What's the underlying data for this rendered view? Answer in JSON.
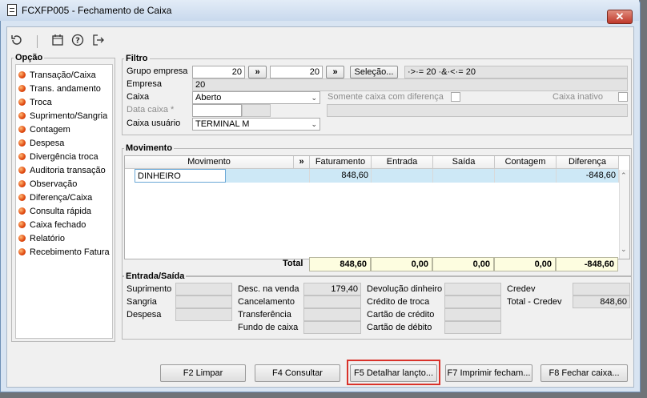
{
  "window": {
    "title": "FCXFP005 - Fechamento de Caixa",
    "close_label": "✕"
  },
  "toolbar": {
    "icons": [
      "refresh-icon",
      "calendar-icon",
      "help-icon",
      "exit-icon"
    ]
  },
  "opcao": {
    "label": "Opção",
    "items": [
      "Transação/Caixa",
      "Trans. andamento",
      "Troca",
      "Suprimento/Sangria",
      "Contagem",
      "Despesa",
      "Divergência troca",
      "Auditoria transação",
      "Observação",
      "Diferença/Caixa",
      "Consulta rápida",
      "Caixa fechado",
      "Relatório",
      "Recebimento Fatura"
    ]
  },
  "filtro": {
    "label": "Filtro",
    "grupo_empresa_label": "Grupo empresa",
    "grupo_empresa_from": "20",
    "grupo_empresa_to": "20",
    "range_btn": "»",
    "selecao_btn": "Seleção...",
    "selection_text": "·>·= 20 ·&·<·= 20",
    "empresa_label": "Empresa",
    "empresa_value": "20",
    "caixa_label": "Caixa",
    "caixa_value": "Aberto",
    "somente_label": "Somente caixa com diferença",
    "inativo_label": "Caixa inativo",
    "data_caixa_label": "Data caixa *",
    "caixa_usuario_label": "Caixa usuário",
    "caixa_usuario_value": "TERMINAL M"
  },
  "movimento": {
    "label": "Movimento",
    "columns": {
      "movimento": "Movimento",
      "expand": "»",
      "faturamento": "Faturamento",
      "entrada": "Entrada",
      "saida": "Saída",
      "contagem": "Contagem",
      "diferenca": "Diferença"
    },
    "rows": [
      {
        "movimento": "DINHEIRO",
        "faturamento": "848,60",
        "entrada": "",
        "saida": "",
        "contagem": "",
        "diferenca": "-848,60"
      }
    ],
    "total_label": "Total",
    "totals": {
      "faturamento": "848,60",
      "entrada": "0,00",
      "saida": "0,00",
      "contagem": "0,00",
      "diferenca": "-848,60"
    }
  },
  "entrada_saida": {
    "label": "Entrada/Saída",
    "suprimento": "Suprimento",
    "sangria": "Sangria",
    "despesa": "Despesa",
    "desc_venda": "Desc. na venda",
    "desc_venda_value": "179,40",
    "cancelamento": "Cancelamento",
    "transferencia": "Transferência",
    "fundo_caixa": "Fundo de caixa",
    "devolucao": "Devolução dinheiro",
    "credito_troca": "Crédito de troca",
    "cartao_credito": "Cartão de crédito",
    "cartao_debito": "Cartão de débito",
    "credev": "Credev",
    "total_credev": "Total - Credev",
    "total_credev_value": "848,60"
  },
  "buttons": {
    "f2": "F2 Limpar",
    "f4": "F4 Consultar",
    "f5": "F5 Detalhar lançto...",
    "f7": "F7 Imprimir fecham...",
    "f8": "F8 Fechar caixa..."
  },
  "colors": {
    "highlight": "#d9322a",
    "selection": "#cde8f6",
    "total_bg": "#fdfde0"
  }
}
